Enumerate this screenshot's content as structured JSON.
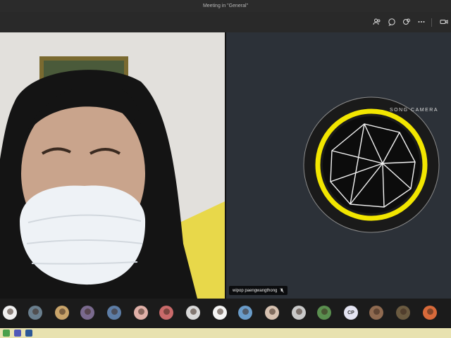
{
  "window": {
    "title": "Meeting in \"General\""
  },
  "toolbar": {
    "icons": [
      "participants-icon",
      "chat-icon",
      "reactions-icon",
      "more-options-icon",
      "camera-icon"
    ]
  },
  "video_tiles": [
    {
      "kind": "camera-feed"
    },
    {
      "kind": "profile-logo",
      "name": "wipop paengwangthong",
      "logo_text": "SONG CAMERA",
      "accent": "#f2e600"
    }
  ],
  "participants": [
    {
      "initials": "",
      "bg": "#f0f0f0"
    },
    {
      "initials": "",
      "bg": "#6a7f8e"
    },
    {
      "initials": "",
      "bg": "#c9a46a"
    },
    {
      "initials": "",
      "bg": "#7a6a8e"
    },
    {
      "initials": "",
      "bg": "#5d7da6"
    },
    {
      "initials": "",
      "bg": "#e0b0a8"
    },
    {
      "initials": "",
      "bg": "#c96a6a"
    },
    {
      "initials": "",
      "bg": "#d9d9d9"
    },
    {
      "initials": "",
      "bg": "#f5f5f5"
    },
    {
      "initials": "",
      "bg": "#6a9cc9"
    },
    {
      "initials": "",
      "bg": "#d6c1b0"
    },
    {
      "initials": "",
      "bg": "#c9c9c9"
    },
    {
      "initials": "",
      "bg": "#5a8f4f"
    },
    {
      "initials": "CP",
      "bg": "#e4e4f2"
    },
    {
      "initials": "",
      "bg": "#8f6a50"
    },
    {
      "initials": "",
      "bg": "#6a5a40"
    },
    {
      "initials": "",
      "bg": "#d86a3a"
    }
  ]
}
